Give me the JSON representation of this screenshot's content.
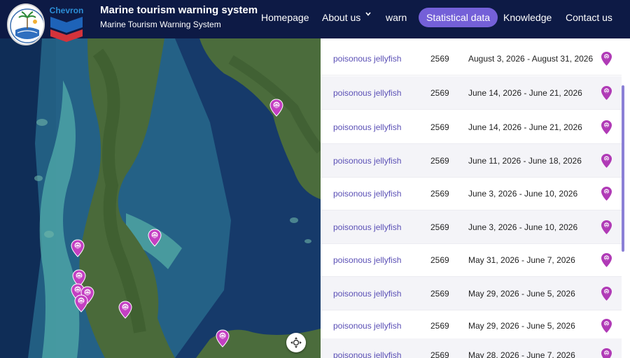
{
  "header": {
    "title": "Marine tourism warning system",
    "subtitle": "Marine Tourism Warning System",
    "chevron_brand": "Chevron",
    "nav": [
      {
        "label": "Homepage"
      },
      {
        "label": "About us"
      },
      {
        "label": "warn"
      },
      {
        "label": "Statistical data",
        "active": true
      },
      {
        "label": "Knowledge"
      },
      {
        "label": "Contact us"
      }
    ]
  },
  "colors": {
    "header_bg": "#0d1a45",
    "nav_active": "#7460d8",
    "link_purple": "#5a4fb5",
    "pin_magenta": "#b03ab6"
  },
  "map": {
    "marker_icon": "jellyfish-pin-icon",
    "locate_icon": "recenter-icon"
  },
  "reports": [
    {
      "name": "poisonous jellyfish",
      "year": "2569",
      "period": "August 3, 2026 - August 31, 2026"
    },
    {
      "name": "poisonous jellyfish",
      "year": "2569",
      "period": "June 14, 2026 - June 21, 2026"
    },
    {
      "name": "poisonous jellyfish",
      "year": "2569",
      "period": "June 14, 2026 - June 21, 2026"
    },
    {
      "name": "poisonous jellyfish",
      "year": "2569",
      "period": "June 11, 2026 - June 18, 2026"
    },
    {
      "name": "poisonous jellyfish",
      "year": "2569",
      "period": "June 3, 2026 - June 10, 2026"
    },
    {
      "name": "poisonous jellyfish",
      "year": "2569",
      "period": "June 3, 2026 - June 10, 2026"
    },
    {
      "name": "poisonous jellyfish",
      "year": "2569",
      "period": "May 31, 2026 - June 7, 2026"
    },
    {
      "name": "poisonous jellyfish",
      "year": "2569",
      "period": "May 29, 2026 - June 5, 2026"
    },
    {
      "name": "poisonous jellyfish",
      "year": "2569",
      "period": "May 29, 2026 - June 5, 2026"
    },
    {
      "name": "poisonous jellyfish",
      "year": "2569",
      "period": "May 28, 2026 - June 7, 2026"
    }
  ]
}
